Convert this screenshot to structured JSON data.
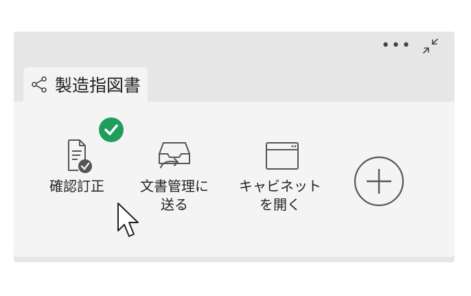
{
  "panel": {
    "more_icon": "more-horizontal-icon",
    "collapse_icon": "collapse-arrows-icon"
  },
  "tab": {
    "icon": "share-icon",
    "label": "製造指図書"
  },
  "actions": [
    {
      "id": "confirm",
      "label_line1": "確認訂正",
      "label_line2": "",
      "icon": "document-check-icon",
      "status_badge": "checkmark-icon"
    },
    {
      "id": "send",
      "label_line1": "文書管理に",
      "label_line2": "送る",
      "icon": "inbox-send-icon"
    },
    {
      "id": "cabinet",
      "label_line1": "キャビネット",
      "label_line2": "を開く",
      "icon": "window-icon"
    },
    {
      "id": "add",
      "label_line1": "",
      "label_line2": "",
      "icon": "plus-circle-icon"
    }
  ],
  "colors": {
    "panel_bg": "#e6e6e6",
    "content_bg": "#f4f4f4",
    "icon_stroke": "#555555",
    "success_green": "#1f9d5a"
  },
  "cursor": "pointer-cursor-icon"
}
